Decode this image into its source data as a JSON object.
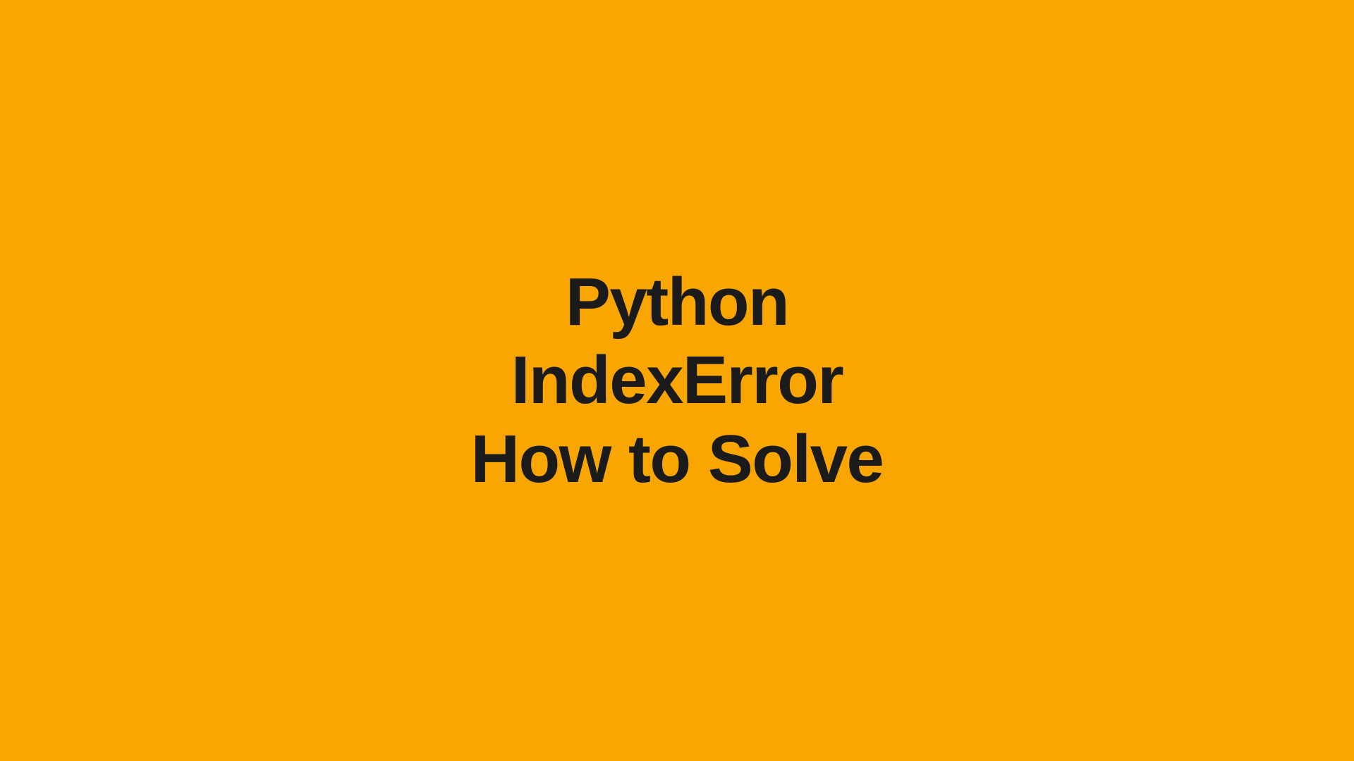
{
  "title": {
    "line1": "Python",
    "line2": "IndexError",
    "line3": "How to Solve"
  },
  "colors": {
    "background": "#f9a602",
    "text": "#1b1b1b"
  }
}
